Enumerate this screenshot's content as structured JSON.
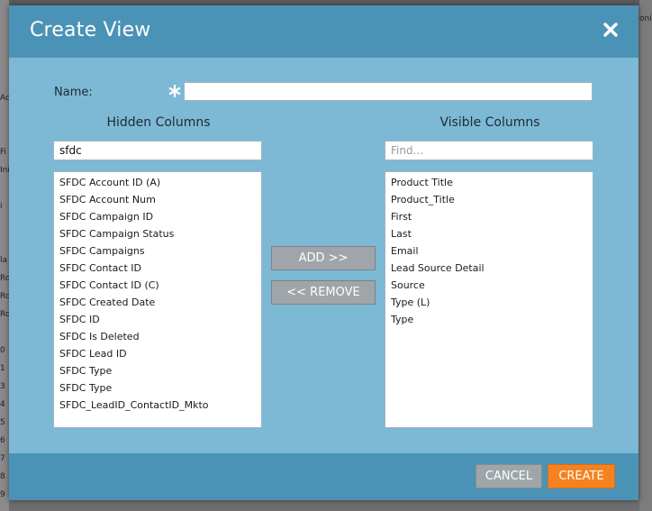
{
  "background_fragments": [
    "Ac",
    "Fi",
    "Ini",
    "i",
    "la",
    "Ro",
    "Ro",
    "Ro",
    "0",
    "1",
    "3",
    "4",
    "5",
    "6",
    "7",
    "8",
    "9",
    "onis"
  ],
  "dialog": {
    "title": "Create View",
    "close_icon": "close-icon",
    "colors": {
      "header": "#4b93b6",
      "body": "#7db9d5",
      "accent": "#f58220",
      "button_gray": "#9fa5a9"
    }
  },
  "name": {
    "label": "Name:",
    "required_marker": "*",
    "value": ""
  },
  "hidden_columns": {
    "heading": "Hidden Columns",
    "search_value": "sfdc",
    "items": [
      "SFDC Account ID (A)",
      "SFDC Account Num",
      "SFDC Campaign ID",
      "SFDC Campaign Status",
      "SFDC Campaigns",
      "SFDC Contact ID",
      "SFDC Contact ID (C)",
      "SFDC Created Date",
      "SFDC ID",
      "SFDC Is Deleted",
      "SFDC Lead ID",
      "SFDC Type",
      "SFDC Type",
      "SFDC_LeadID_ContactID_Mkto"
    ]
  },
  "visible_columns": {
    "heading": "Visible Columns",
    "search_value": "",
    "search_placeholder": "Find...",
    "items": [
      "Product Title",
      "Product_Title",
      "First",
      "Last",
      "Email",
      "Lead Source Detail",
      "Source",
      "Type (L)",
      "Type"
    ]
  },
  "transfer": {
    "add_label": "ADD >>",
    "remove_label": "<< REMOVE"
  },
  "footer": {
    "cancel_label": "CANCEL",
    "create_label": "CREATE"
  }
}
